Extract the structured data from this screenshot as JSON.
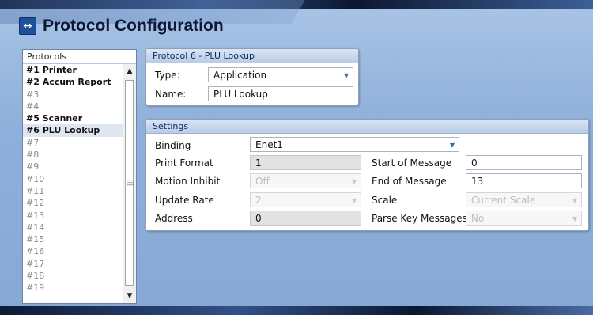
{
  "title": "Protocol Configuration",
  "title_icon": "bidirectional-arrow-icon",
  "protocols_list": {
    "header": "Protocols",
    "items": [
      {
        "label": "#1 Printer",
        "configured": true
      },
      {
        "label": "#2 Accum Report",
        "configured": true
      },
      {
        "label": "#3",
        "configured": false
      },
      {
        "label": "#4",
        "configured": false
      },
      {
        "label": "#5 Scanner",
        "configured": true
      },
      {
        "label": "#6 PLU Lookup",
        "configured": true,
        "selected": true
      },
      {
        "label": "#7",
        "configured": false
      },
      {
        "label": "#8",
        "configured": false
      },
      {
        "label": "#9",
        "configured": false
      },
      {
        "label": "#10",
        "configured": false
      },
      {
        "label": "#11",
        "configured": false
      },
      {
        "label": "#12",
        "configured": false
      },
      {
        "label": "#13",
        "configured": false
      },
      {
        "label": "#14",
        "configured": false
      },
      {
        "label": "#15",
        "configured": false
      },
      {
        "label": "#16",
        "configured": false
      },
      {
        "label": "#17",
        "configured": false
      },
      {
        "label": "#18",
        "configured": false
      },
      {
        "label": "#19",
        "configured": false
      }
    ]
  },
  "protocol_panel": {
    "header": "Protocol 6 - PLU Lookup",
    "type_label": "Type:",
    "type_value": "Application",
    "name_label": "Name:",
    "name_value": "PLU Lookup"
  },
  "settings": {
    "header": "Settings",
    "binding_label": "Binding",
    "binding_value": "Enet1",
    "print_format_label": "Print Format",
    "print_format_value": "1",
    "motion_inhibit_label": "Motion Inhibit",
    "motion_inhibit_value": "Off",
    "update_rate_label": "Update Rate",
    "update_rate_value": "2",
    "address_label": "Address",
    "address_value": "0",
    "start_of_message_label": "Start of Message",
    "start_of_message_value": "0",
    "end_of_message_label": "End of Message",
    "end_of_message_value": "13",
    "scale_label": "Scale",
    "scale_value": "Current Scale",
    "parse_key_label": "Parse Key Messages",
    "parse_key_value": "No"
  },
  "colors": {
    "background": "#8fb0d9",
    "title_text": "#0b1733",
    "panel_header_text": "#0b2b66",
    "dropdown_arrow": "#3569b8"
  }
}
